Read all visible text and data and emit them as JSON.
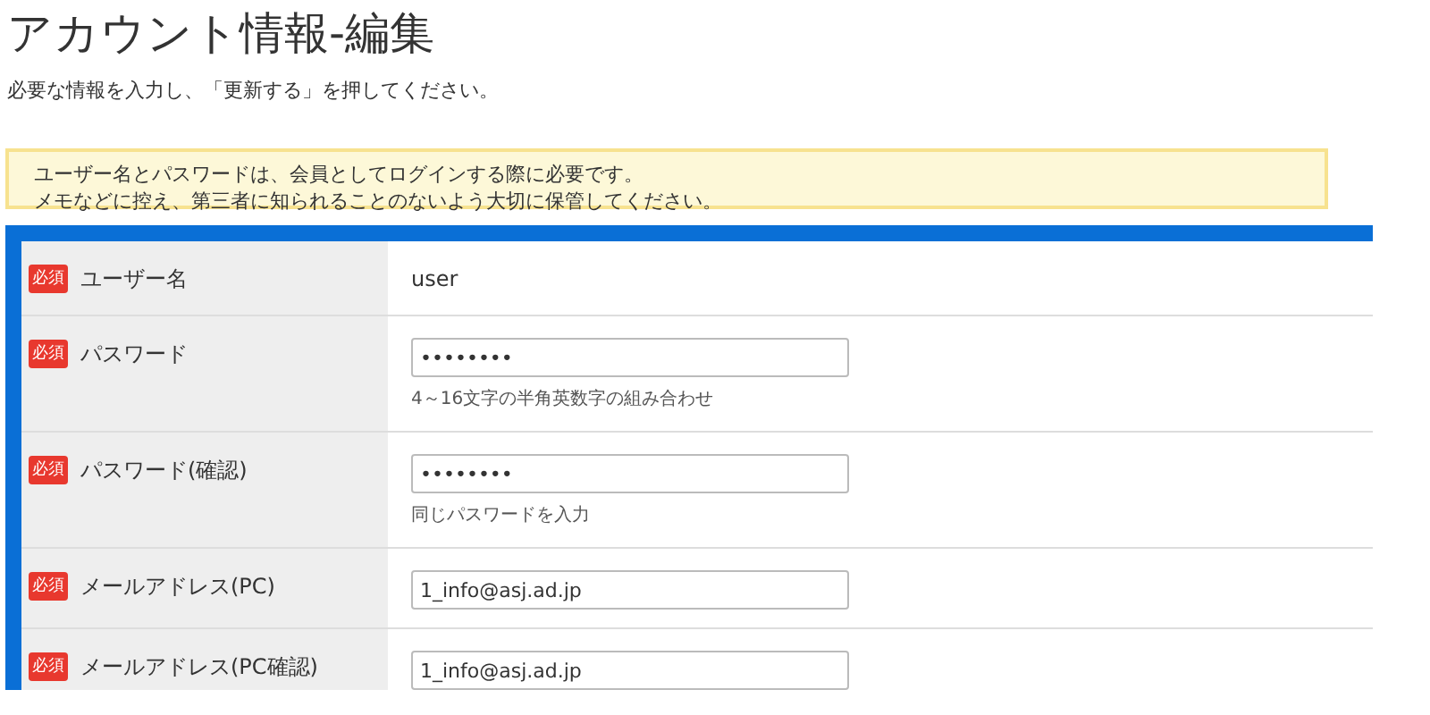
{
  "title": "アカウント情報-編集",
  "instruction": "必要な情報を入力し、「更新する」を押してください。",
  "notice": [
    "ユーザー名とパスワードは、会員としてログインする際に必要です。",
    "メモなどに控え、第三者に知られることのないよう大切に保管してください。"
  ],
  "rows": [
    {
      "badge": "必須",
      "label": "ユーザー名",
      "kind": "text",
      "value": "user"
    },
    {
      "badge": "必須",
      "label": "パスワード",
      "kind": "input",
      "value": "••••••••",
      "hint": "4～16文字の半角英数字の組み合わせ"
    },
    {
      "badge": "必須",
      "label": "パスワード(確認)",
      "kind": "input",
      "value": "••••••••",
      "hint": "同じパスワードを入力"
    },
    {
      "badge": "必須",
      "label": "メールアドレス(PC)",
      "kind": "input",
      "value": "1_info@asj.ad.jp"
    },
    {
      "badge": "必須",
      "label": "メールアドレス(PC確認)",
      "kind": "input",
      "value": "1_info@asj.ad.jp"
    }
  ]
}
